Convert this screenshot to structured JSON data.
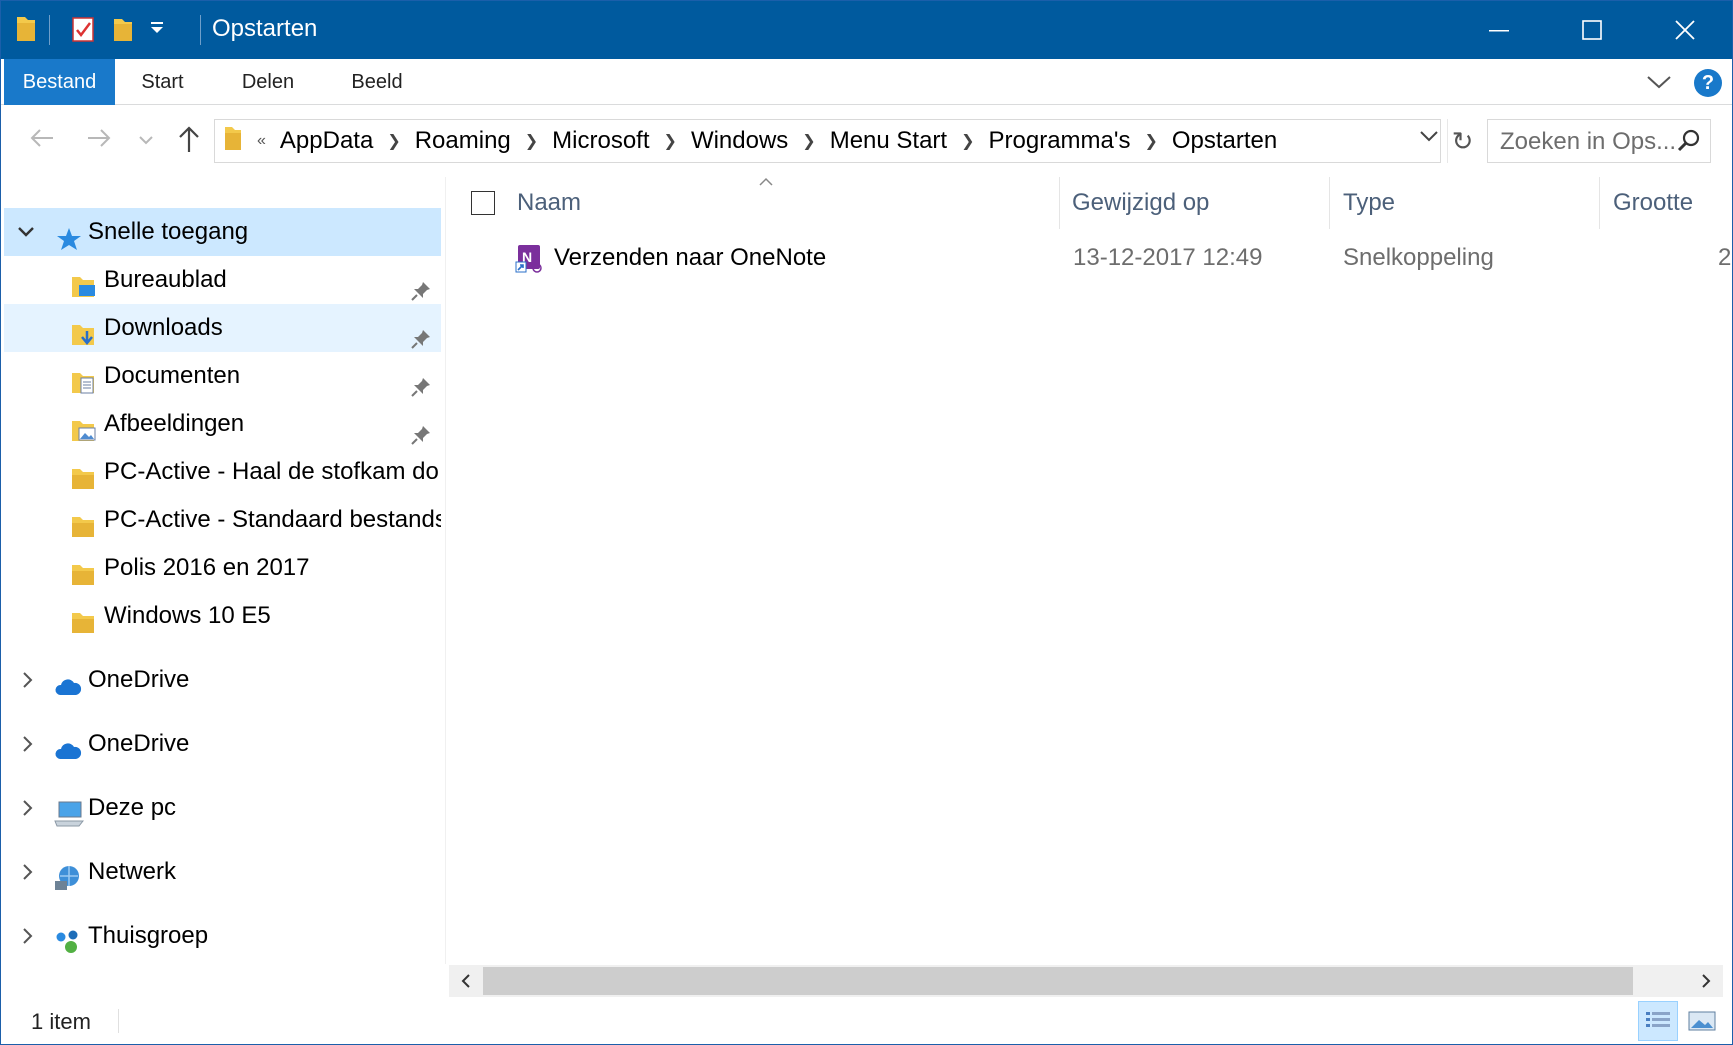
{
  "window": {
    "title": "Opstarten",
    "accent_color": "#005a9e",
    "minimize_icon": "minimize-icon",
    "maximize_icon": "maximize-icon",
    "close_icon": "close-icon"
  },
  "ribbon": {
    "tabs": [
      {
        "label": "Bestand",
        "active": true
      },
      {
        "label": "Start"
      },
      {
        "label": "Delen"
      },
      {
        "label": "Beeld"
      }
    ],
    "help_label": "?"
  },
  "address": {
    "overflow": "«",
    "crumbs": [
      "AppData",
      "Roaming",
      "Microsoft",
      "Windows",
      "Menu Start",
      "Programma's",
      "Opstarten"
    ],
    "refresh_glyph": "↻"
  },
  "search": {
    "placeholder": "Zoeken in Ops..."
  },
  "nav": {
    "quick_access": {
      "label": "Snelle toegang",
      "icon": "star-icon"
    },
    "quick_items": [
      {
        "label": "Bureaublad",
        "icon": "desktop-folder-icon",
        "pinned": true
      },
      {
        "label": "Downloads",
        "icon": "downloads-folder-icon",
        "pinned": true
      },
      {
        "label": "Documenten",
        "icon": "documents-folder-icon",
        "pinned": true
      },
      {
        "label": "Afbeeldingen",
        "icon": "pictures-folder-icon",
        "pinned": true
      },
      {
        "label": "PC-Active - Haal de stofkam do",
        "icon": "folder-icon",
        "pinned": false
      },
      {
        "label": "PC-Active - Standaard bestands",
        "icon": "folder-icon",
        "pinned": false
      },
      {
        "label": "Polis 2016 en 2017",
        "icon": "folder-icon",
        "pinned": false
      },
      {
        "label": "Windows 10 E5",
        "icon": "folder-icon",
        "pinned": false
      }
    ],
    "roots": [
      {
        "label": "OneDrive",
        "icon": "onedrive-icon"
      },
      {
        "label": "OneDrive",
        "icon": "onedrive-icon"
      },
      {
        "label": "Deze pc",
        "icon": "computer-icon"
      },
      {
        "label": "Netwerk",
        "icon": "network-icon"
      },
      {
        "label": "Thuisgroep",
        "icon": "homegroup-icon"
      }
    ]
  },
  "columns": {
    "name": "Naam",
    "modified": "Gewijzigd op",
    "type": "Type",
    "size": "Grootte"
  },
  "files": [
    {
      "name": "Verzenden naar OneNote",
      "modified": "13-12-2017 12:49",
      "type": "Snelkoppeling",
      "size": "2",
      "icon": "onenote-shortcut-icon"
    }
  ],
  "status": {
    "count": "1 item"
  }
}
